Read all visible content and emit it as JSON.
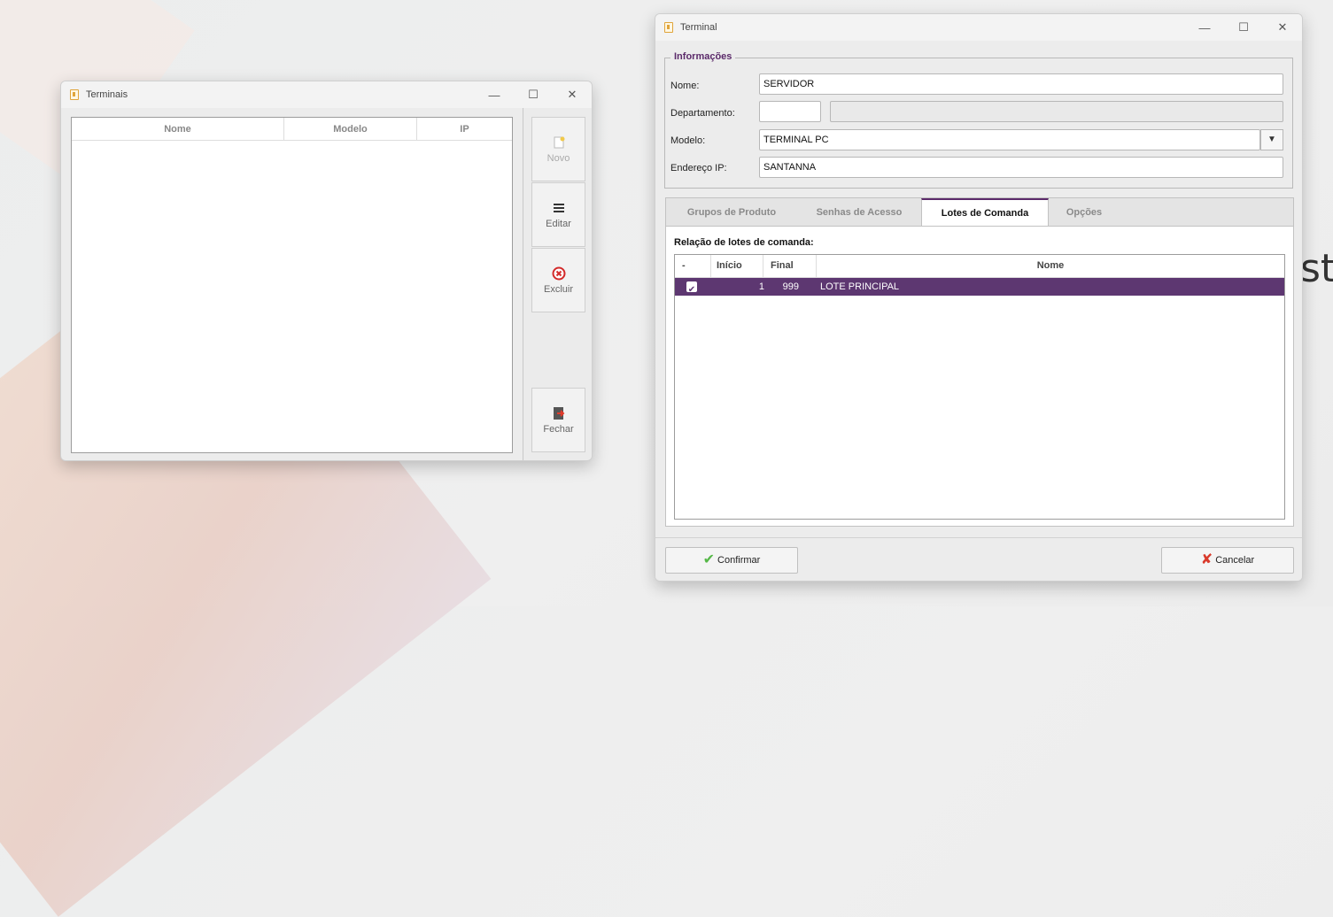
{
  "terminais_window": {
    "title": "Terminais",
    "columns": [
      "Nome",
      "Modelo",
      "IP"
    ],
    "buttons": {
      "novo": "Novo",
      "editar": "Editar",
      "excluir": "Excluir",
      "fechar": "Fechar"
    }
  },
  "terminal_window": {
    "title": "Terminal",
    "info_group": {
      "title": "Informações",
      "nome_label": "Nome:",
      "nome_value": "SERVIDOR",
      "departamento_label": "Departamento:",
      "departamento_code": "",
      "departamento_name": "",
      "modelo_label": "Modelo:",
      "modelo_value": "TERMINAL PC",
      "ip_label": "Endereço IP:",
      "ip_value": "SANTANNA"
    },
    "tabs": [
      "Grupos de Produto",
      "Senhas de Acesso",
      "Lotes de Comanda",
      "Opções"
    ],
    "active_tab": "Lotes de Comanda",
    "pane_title": "Relação de lotes de comanda:",
    "grid": {
      "columns": [
        "-",
        "Início",
        "Final",
        "Nome"
      ],
      "rows": [
        {
          "checked": true,
          "inicio": "1",
          "final": "999",
          "nome": "LOTE PRINCIPAL"
        }
      ]
    },
    "confirm_label": "Confirmar",
    "cancel_label": "Cancelar"
  },
  "desktop": {
    "partial_text": "st"
  },
  "colors": {
    "accent": "#5b2a6a",
    "selected_row": "#5d3771",
    "confirm_icon": "#56b848",
    "cancel_icon": "#d93a2b",
    "delete_icon": "#d32a2a"
  },
  "icons": {
    "novo": "new-document-icon",
    "editar": "list-icon",
    "excluir": "delete-circle-icon",
    "fechar": "exit-door-icon",
    "confirmar": "checkmark-icon",
    "cancelar": "x-mark-icon"
  }
}
